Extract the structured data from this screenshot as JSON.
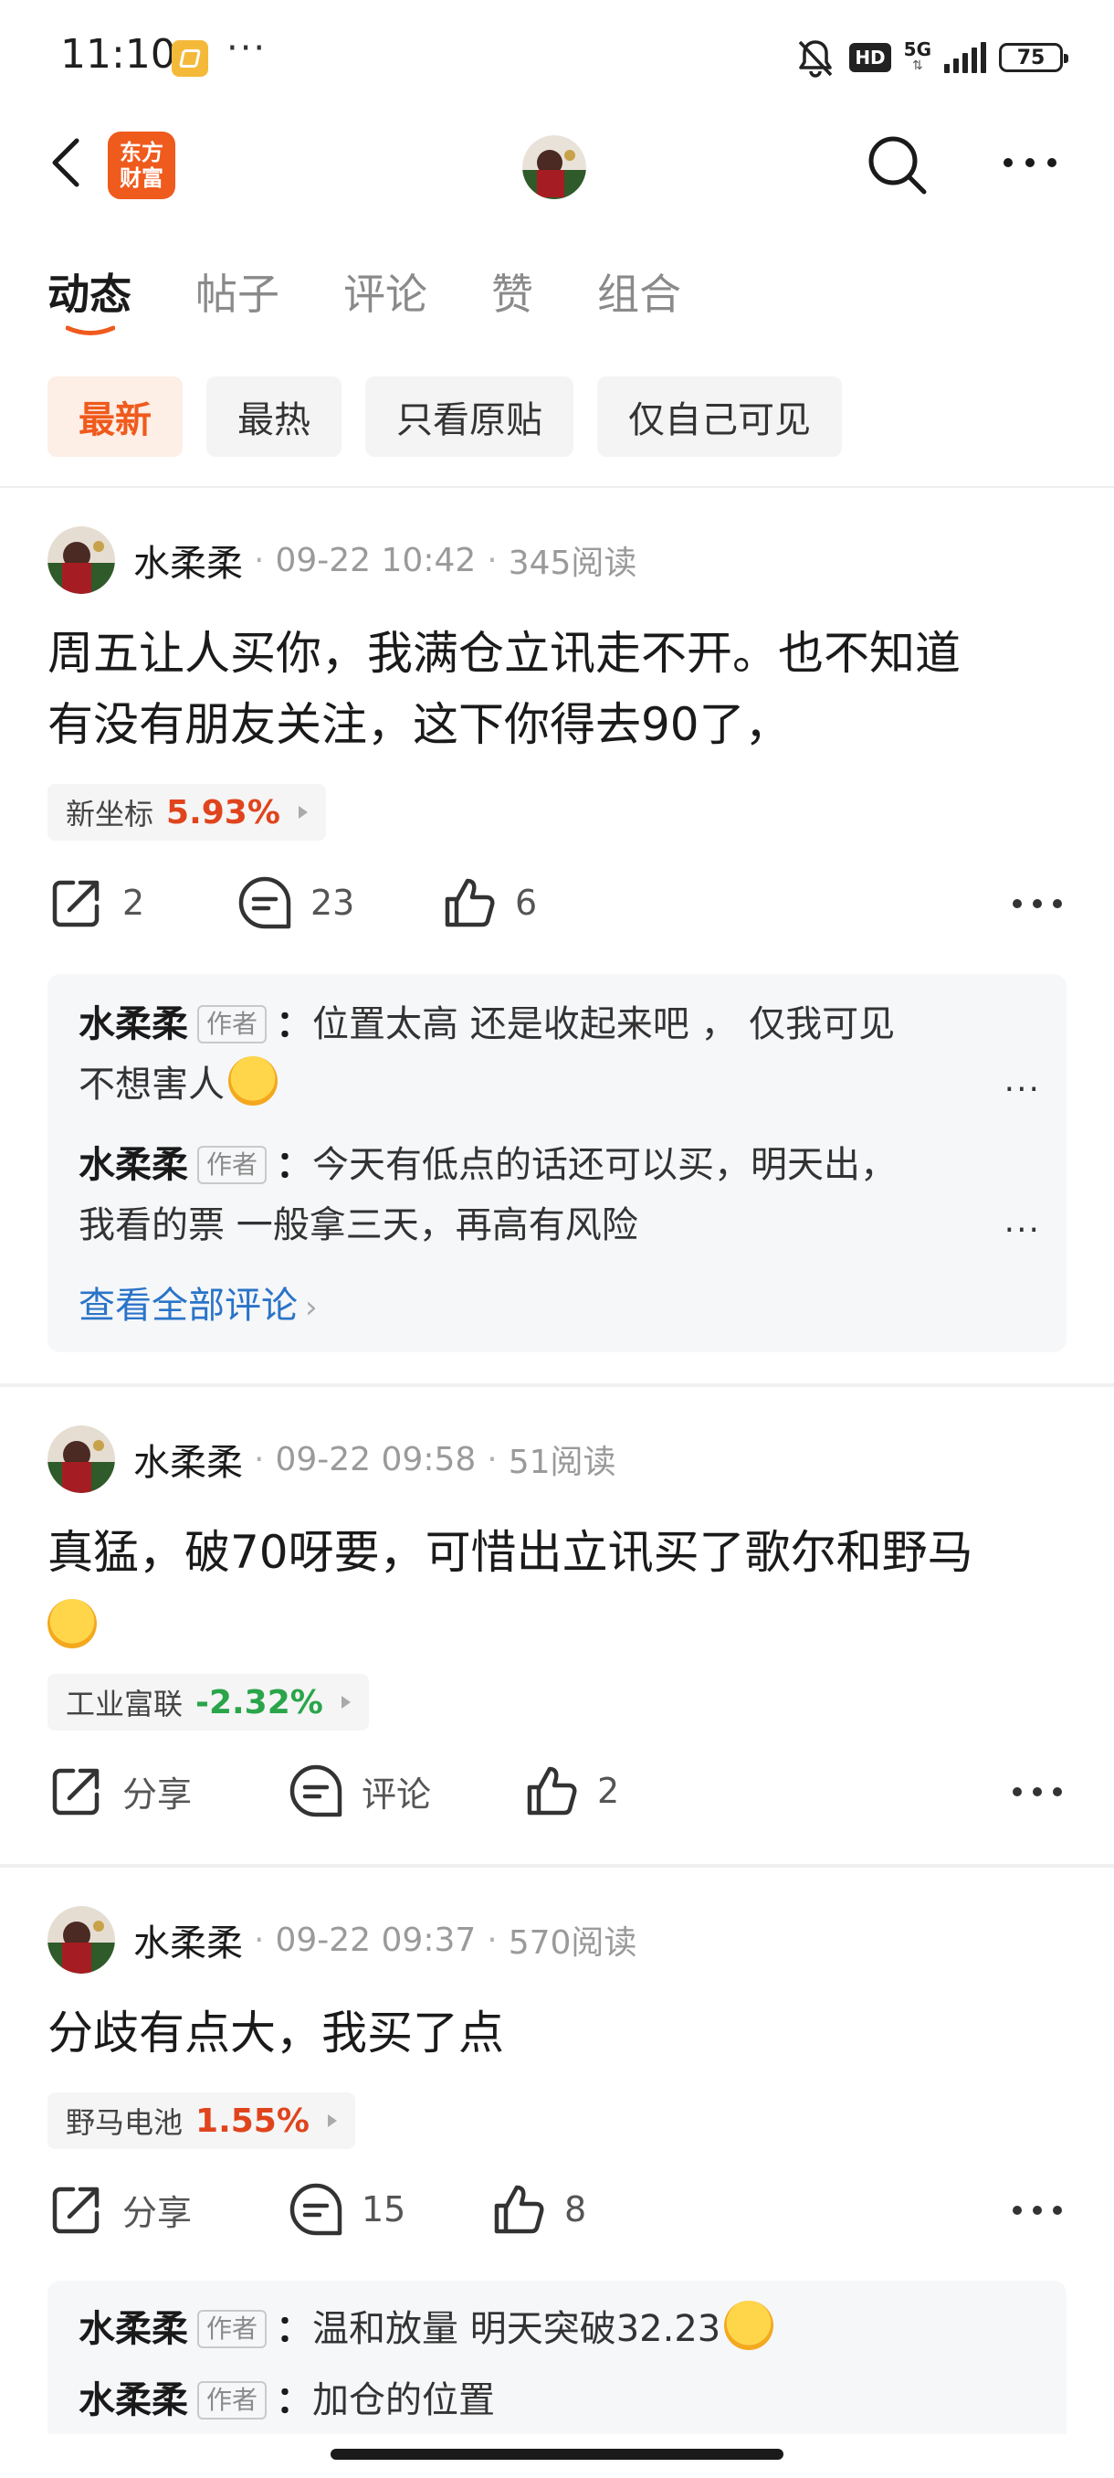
{
  "status_bar": {
    "time": "11:10",
    "dots": "···",
    "hd": "HD",
    "network": "5G",
    "battery": "75"
  },
  "header": {
    "logo_line1": "东方",
    "logo_line2": "财富"
  },
  "tabs": [
    "动态",
    "帖子",
    "评论",
    "赞",
    "组合"
  ],
  "active_tab": 0,
  "filters": [
    "最新",
    "最热",
    "只看原贴",
    "仅自己可见"
  ],
  "active_filter": 0,
  "colors": {
    "accent": "#ef5a1d",
    "up": "#e0441d",
    "down": "#2aa54a",
    "link": "#2a74c8"
  },
  "posts": [
    {
      "author": "水柔柔",
      "time": "09-22 10:42",
      "reads": "345阅读",
      "content_line1": "周五让人买你，我满仓立讯走不开。也不知道",
      "content_line2": "有没有朋友关注，这下你得去90了，",
      "stock": {
        "name": "新坐标",
        "change": "5.93%"
      },
      "shares": "2",
      "comment_count": "23",
      "likes": "6",
      "comments": [
        {
          "author": "水柔柔",
          "tag": "作者",
          "line1": "位置太高 还是收起来吧 ，  仅我可见",
          "line2": "不想害人",
          "more": "..."
        },
        {
          "author": "水柔柔",
          "tag": "作者",
          "line1": "今天有低点的话还可以买，明天出，",
          "line2": "我看的票 一般拿三天，再高有风险",
          "more": "..."
        }
      ],
      "view_all": "查看全部评论"
    },
    {
      "author": "水柔柔",
      "time": "09-22 09:58",
      "reads": "51阅读",
      "content_line1": "真猛，破70呀要，可惜出立讯买了歌尔和野马",
      "stock": {
        "name": "工业富联",
        "change": "-2.32%"
      },
      "shares": "分享",
      "comment_count": "评论",
      "likes": "2"
    },
    {
      "author": "水柔柔",
      "time": "09-22 09:37",
      "reads": "570阅读",
      "content_line1": "分歧有点大，我买了点",
      "stock": {
        "name": "野马电池",
        "change": "1.55%"
      },
      "shares": "分享",
      "comment_count": "15",
      "likes": "8",
      "comments": [
        {
          "author": "水柔柔",
          "tag": "作者",
          "line1": "温和放量 明天突破32.23"
        },
        {
          "author": "水柔柔",
          "tag": "作者",
          "line1": "加仓的位置"
        }
      ]
    }
  ]
}
